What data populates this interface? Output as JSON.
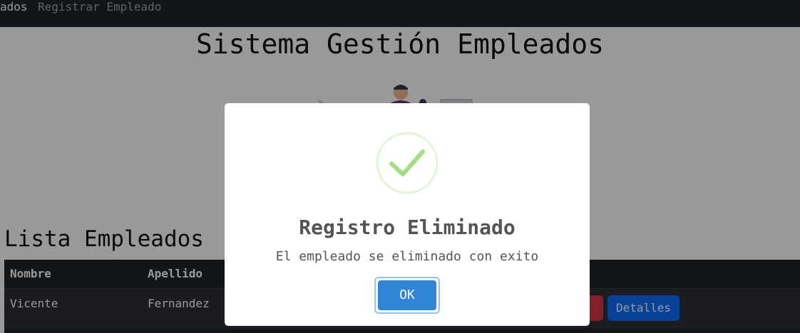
{
  "navbar": {
    "brand": "ados",
    "register_link": "Registrar Empleado"
  },
  "page": {
    "title": "Sistema Gestión Empleados",
    "section_title": "Lista Empleados"
  },
  "table": {
    "headers": [
      "Nombre",
      "Apellido"
    ],
    "rows": [
      {
        "nombre": "Vicente",
        "apellido": "Fernandez",
        "details_label": "Detalles"
      }
    ]
  },
  "modal": {
    "title": "Registro Eliminado",
    "text": "El empleado se eliminado con exito",
    "ok_label": "OK",
    "icon": "success-check-icon"
  },
  "colors": {
    "navbar": "#212529",
    "table": "#212529",
    "primary": "#0d6efd",
    "danger": "#dc3545",
    "success": "#a5dc86",
    "confirm": "#3085d6"
  }
}
